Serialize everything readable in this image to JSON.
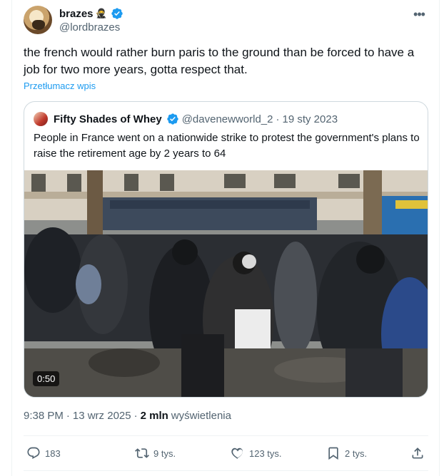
{
  "author": {
    "display_name": "brazes",
    "emoji": "🥷",
    "handle": "@lordbrazes"
  },
  "more_label": "•••",
  "tweet_text": "the french would rather burn paris to the ground than be forced to have a job for two more years, gotta respect that.",
  "translate_label": "Przetłumacz wpis",
  "quote": {
    "display_name": "Fifty Shades of Whey",
    "handle": "@davenewworld_2",
    "separator": "·",
    "date": "19 sty 2023",
    "text": "People in France went on a nationwide strike to protest the government's plans to raise the retirement age by 2 years to 64",
    "video_duration": "0:50"
  },
  "meta": {
    "time": "9:38 PM",
    "separator": "·",
    "date": "13 wrz 2025",
    "dot": "·",
    "views_count": "2 mln",
    "views_label": "wyświetlenia"
  },
  "actions": {
    "replies": "183",
    "reposts": "9 tys.",
    "likes": "123 tys.",
    "bookmarks": "2 tys."
  },
  "colors": {
    "accent": "#1d9bf0",
    "secondary_text": "#536471",
    "border": "#cfd9de"
  }
}
